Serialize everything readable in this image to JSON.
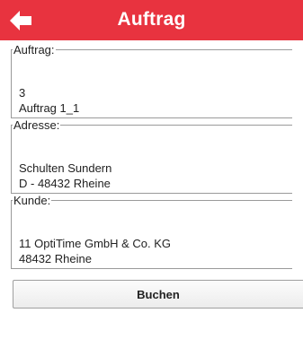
{
  "header": {
    "title": "Auftrag",
    "back_icon": "arrow-left-icon",
    "color": "#e8333f"
  },
  "auftrag": {
    "legend": "Auftrag:",
    "number": "3",
    "name": "Auftrag 1_1"
  },
  "adresse": {
    "legend": "Adresse:",
    "line1": "Schulten Sundern",
    "line2": "D - 48432 Rheine"
  },
  "kunde": {
    "legend": "Kunde:",
    "line1": "11 OptiTime GmbH & Co. KG",
    "line2": "48432 Rheine"
  },
  "action": {
    "book_label": "Buchen"
  }
}
